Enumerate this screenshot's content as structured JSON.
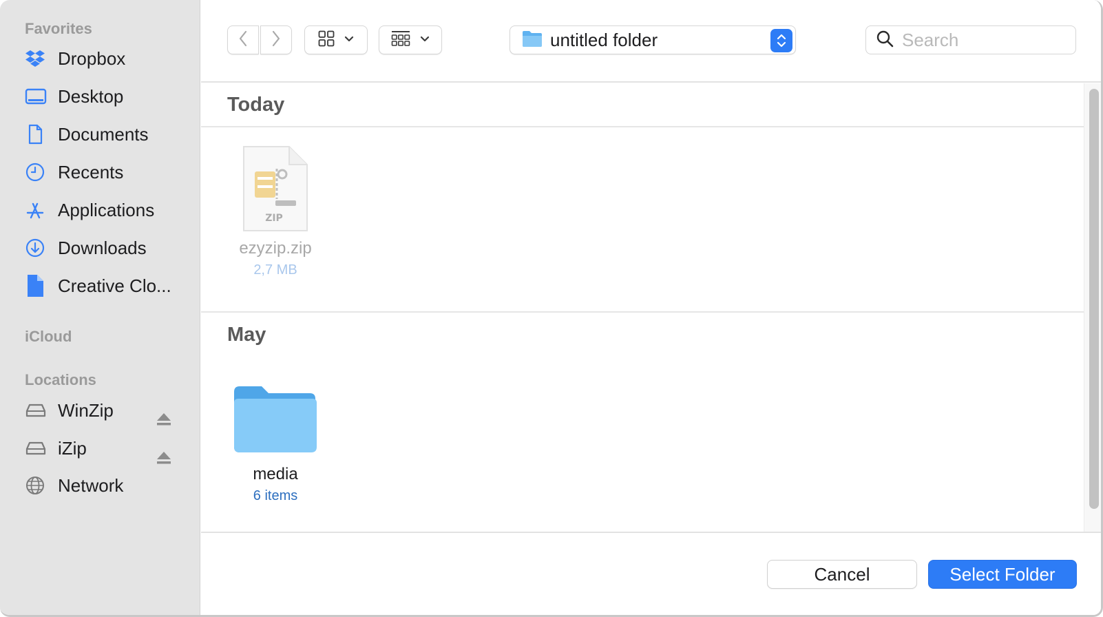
{
  "colors": {
    "accent": "#2d7cf6",
    "sidebar_icon": "#3a82f7",
    "folder_blue": "#82c7f7"
  },
  "sidebar": {
    "favorites_heading": "Favorites",
    "favorites": [
      {
        "label": "Dropbox",
        "icon": "dropbox-icon"
      },
      {
        "label": "Desktop",
        "icon": "desktop-icon"
      },
      {
        "label": "Documents",
        "icon": "document-icon"
      },
      {
        "label": "Recents",
        "icon": "clock-icon"
      },
      {
        "label": "Applications",
        "icon": "applications-icon"
      },
      {
        "label": "Downloads",
        "icon": "download-icon"
      },
      {
        "label": "Creative Clo...",
        "icon": "file-icon"
      }
    ],
    "icloud_heading": "iCloud",
    "locations_heading": "Locations",
    "locations": [
      {
        "label": "WinZip",
        "icon": "drive-icon",
        "ejectable": true
      },
      {
        "label": "iZip",
        "icon": "drive-icon",
        "ejectable": true
      },
      {
        "label": "Network",
        "icon": "globe-icon",
        "ejectable": false
      }
    ]
  },
  "toolbar": {
    "current_folder": "untitled folder",
    "search_placeholder": "Search"
  },
  "groups": [
    {
      "title": "Today",
      "items": [
        {
          "name": "ezyzip.zip",
          "meta": "2,7 MB",
          "type": "zip",
          "badge": "ZIP",
          "dimmed": true
        }
      ]
    },
    {
      "title": "May",
      "items": [
        {
          "name": "media",
          "meta": "6 items",
          "type": "folder",
          "dimmed": false
        }
      ]
    }
  ],
  "footer": {
    "cancel_label": "Cancel",
    "primary_label": "Select Folder"
  }
}
